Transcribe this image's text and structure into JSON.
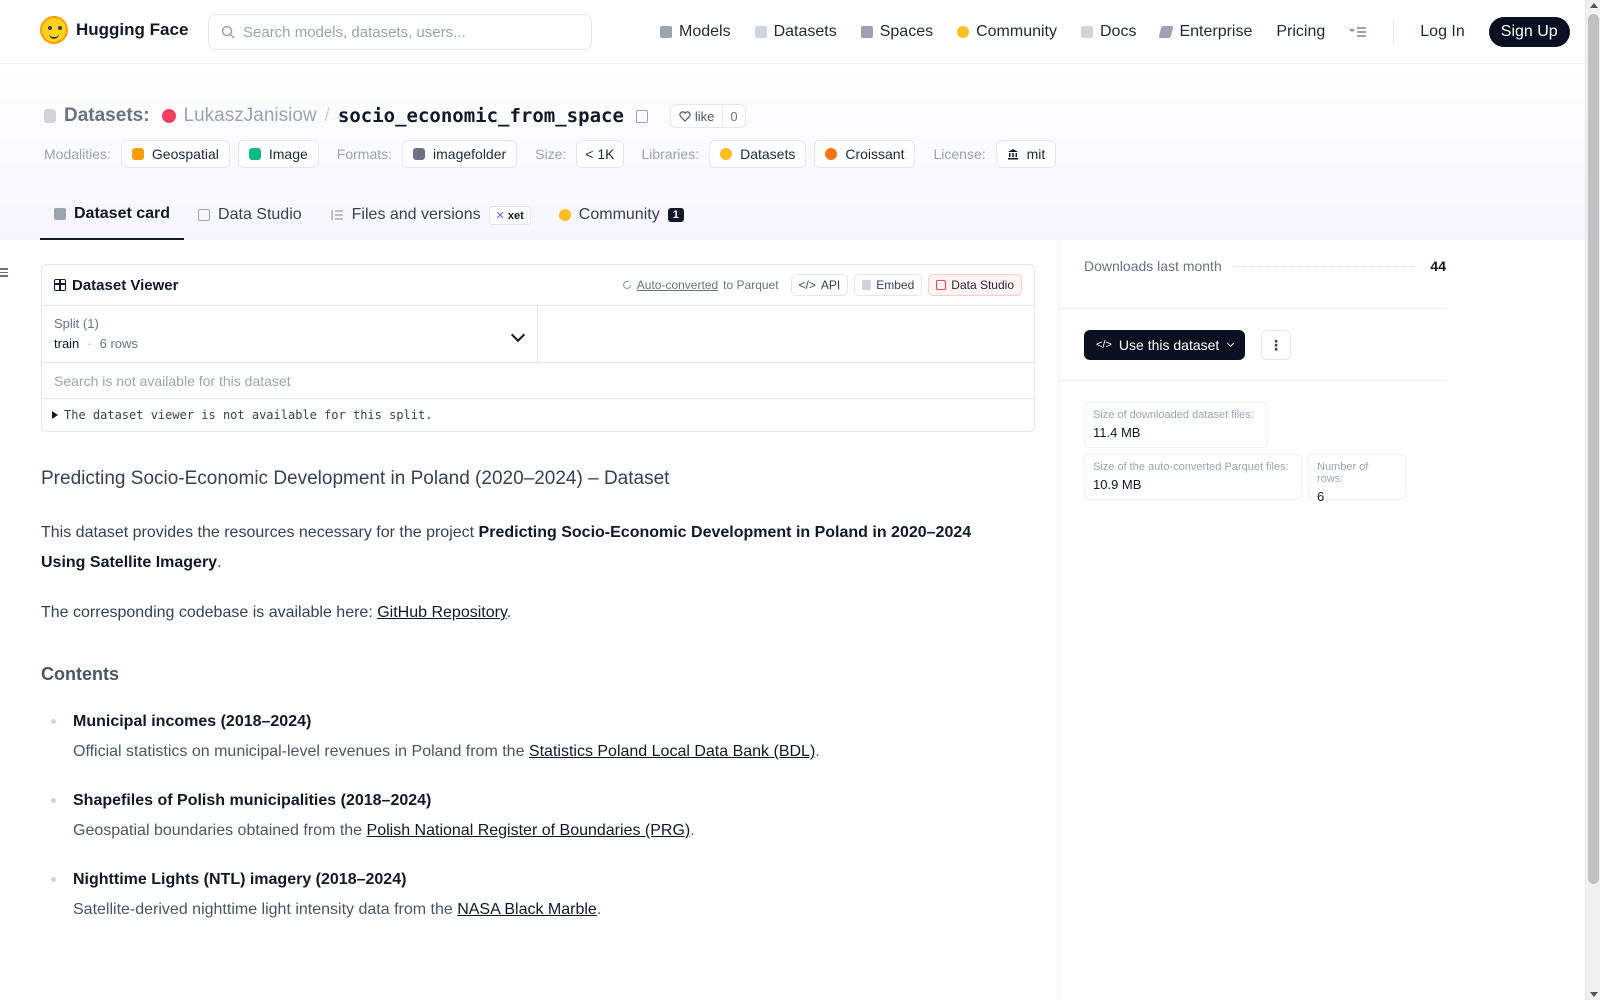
{
  "nav": {
    "brand": "Hugging Face",
    "search_placeholder": "Search models, datasets, users...",
    "links": [
      {
        "label": "Models",
        "icon": "models-icon",
        "color": "#9ca3af"
      },
      {
        "label": "Datasets",
        "icon": "datasets-icon",
        "color": "#d1d5db"
      },
      {
        "label": "Spaces",
        "icon": "spaces-icon",
        "color": "#9ca3af"
      },
      {
        "label": "Community",
        "icon": "community-icon",
        "color": "#fbbf24"
      },
      {
        "label": "Docs",
        "icon": "docs-icon",
        "color": "#d1d5db"
      },
      {
        "label": "Enterprise",
        "icon": "enterprise-icon",
        "color": "#9ca3af"
      },
      {
        "label": "Pricing"
      }
    ],
    "login": "Log In",
    "signup": "Sign Up"
  },
  "header": {
    "section_label": "Datasets:",
    "owner": "LukaszJanisiow",
    "separator": "/",
    "repo": "socio_economic_from_space",
    "like_label": "like",
    "like_count": "0",
    "tag_groups": [
      {
        "label": "Modalities:",
        "tags": [
          {
            "label": "Geospatial",
            "icon_color": "#f59e0b"
          },
          {
            "label": "Image",
            "icon_color": "#10b981"
          }
        ]
      },
      {
        "label": "Formats:",
        "tags": [
          {
            "label": "imagefolder",
            "icon_color": "#6b7280"
          }
        ]
      },
      {
        "label": "Size:",
        "tags": [
          {
            "label": "< 1K"
          }
        ]
      },
      {
        "label": "Libraries:",
        "tags": [
          {
            "label": "Datasets",
            "icon_color": "#fbbf24"
          },
          {
            "label": "Croissant",
            "icon_color": "#f97316"
          }
        ]
      },
      {
        "label": "License:",
        "tags": [
          {
            "label": "mit",
            "icon_color": "#111827"
          }
        ]
      }
    ],
    "tabs": [
      {
        "label": "Dataset card",
        "active": true
      },
      {
        "label": "Data Studio"
      },
      {
        "label": "Files and versions",
        "badge": "xet"
      },
      {
        "label": "Community",
        "count": "1"
      }
    ]
  },
  "viewer": {
    "title": "Dataset Viewer",
    "auto_converted": "Auto-converted",
    "to_parquet": "to Parquet",
    "api": "API",
    "embed": "Embed",
    "data_studio": "Data Studio",
    "split_label": "Split (1)",
    "split_value": "train",
    "split_dot": "·",
    "split_rows": "6 rows",
    "search_note": "Search is not available for this dataset",
    "unavailable_note": "The dataset viewer is not available for this split."
  },
  "content": {
    "heading": "Predicting Socio-Economic Development in Poland (2020–2024) – Dataset",
    "p1_prefix": "This dataset provides the resources necessary for the project ",
    "p1_bold": "Predicting Socio-Economic Development in Poland in 2020–2024 Using Satellite Imagery",
    "p1_suffix": ".",
    "p2_prefix": "The corresponding codebase is available here: ",
    "p2_link": "GitHub Repository",
    "p2_suffix": ".",
    "contents_heading": "Contents",
    "items": [
      {
        "title": "Municipal incomes (2018–2024)",
        "desc_prefix": "Official statistics on municipal-level revenues in Poland from the ",
        "link": "Statistics Poland Local Data Bank (BDL)",
        "desc_suffix": "."
      },
      {
        "title": "Shapefiles of Polish municipalities (2018–2024)",
        "desc_prefix": "Geospatial boundaries obtained from the ",
        "link": "Polish National Register of Boundaries (PRG)",
        "desc_suffix": "."
      },
      {
        "title": "Nighttime Lights (NTL) imagery (2018–2024)",
        "desc_prefix": "Satellite-derived nighttime light intensity data from the ",
        "link": "NASA Black Marble",
        "desc_suffix": "."
      }
    ]
  },
  "sidebar": {
    "downloads_label": "Downloads last month",
    "downloads_value": "44",
    "use_button": "Use this dataset",
    "stats": [
      {
        "label": "Size of downloaded dataset files:",
        "value": "11.4 MB"
      },
      {
        "label": "Size of the auto-converted Parquet files:",
        "value": "10.9 MB"
      },
      {
        "label": "Number of rows:",
        "value": "6"
      }
    ]
  }
}
